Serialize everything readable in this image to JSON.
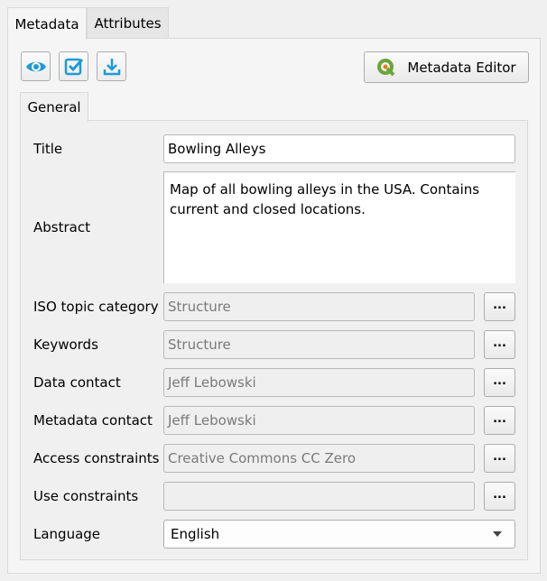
{
  "tabs": [
    {
      "label": "Metadata",
      "active": true
    },
    {
      "label": "Attributes",
      "active": false
    }
  ],
  "toolbar": {
    "icons": [
      "eye-icon",
      "checkbox-icon",
      "download-icon"
    ],
    "editor_button": "Metadata Editor",
    "accent": "#1e9ad6"
  },
  "subtab": "General",
  "fields": {
    "title": {
      "label": "Title",
      "value": "Bowling Alleys"
    },
    "abstract": {
      "label": "Abstract",
      "value": "Map of all bowling alleys in the USA. Contains current and closed locations."
    },
    "rows": [
      {
        "label": "ISO topic category",
        "value": "Structure"
      },
      {
        "label": "Keywords",
        "value": "Structure"
      },
      {
        "label": "Data contact",
        "value": "Jeff Lebowski"
      },
      {
        "label": "Metadata contact",
        "value": "Jeff Lebowski"
      },
      {
        "label": "Access constraints",
        "value": "Creative Commons CC Zero"
      },
      {
        "label": "Use constraints",
        "value": ""
      }
    ],
    "ellipsis": "...",
    "language": {
      "label": "Language",
      "value": "English"
    }
  }
}
